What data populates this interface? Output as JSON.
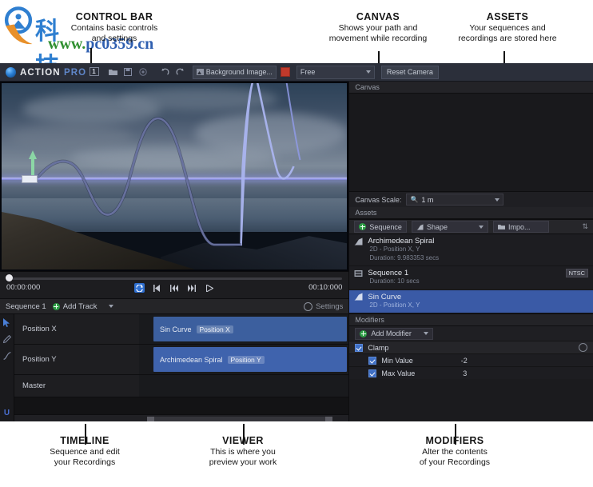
{
  "annotations": {
    "control_bar": {
      "title": "CONTROL BAR",
      "desc": "Contains basic controls\nand settings"
    },
    "canvas": {
      "title": "CANVAS",
      "desc": "Shows your path and\nmovement while recording"
    },
    "assets": {
      "title": "ASSETS",
      "desc": "Your sequences and\nrecordings are stored here"
    },
    "timeline": {
      "title": "TIMELINE",
      "desc": "Sequence and edit\nyour Recordings"
    },
    "viewer": {
      "title": "VIEWER",
      "desc": "This is where you\npreview your work"
    },
    "modifiers": {
      "title": "MODIFIERS",
      "desc": "Alter the contents\nof your Recordings"
    }
  },
  "watermark": {
    "chinese": "科技软件园",
    "url_www": "www.",
    "url_main": "pc0359",
    "url_tld": ".cn"
  },
  "control_bar": {
    "brand_action": "ACTION",
    "brand_pro": "PRO",
    "brand_badge": "1",
    "icons": [
      "folder-icon",
      "save-icon",
      "record-icon",
      "undo-icon",
      "redo-icon"
    ],
    "background_field": "Background Image...",
    "camera_mode": "Free",
    "reset_camera": "Reset Camera"
  },
  "timebar": {
    "current_time": "00:00:000",
    "end_time": "00:10:000",
    "transport": [
      "loop-icon",
      "skip-start-icon",
      "step-back-icon",
      "step-forward-icon",
      "play-icon"
    ]
  },
  "sequence_bar": {
    "sequence_name": "Sequence 1",
    "add_track": "Add Track",
    "settings": "Settings"
  },
  "tools": [
    "select-tool-icon",
    "pen-tool-icon",
    "curve-tool-icon",
    "u-tool-icon"
  ],
  "tracks": [
    {
      "name": "Position X",
      "clip_label": "Sin Curve",
      "clip_pill": "Position X",
      "has_clip": true
    },
    {
      "name": "Position Y",
      "clip_label": "Archimedean Spiral",
      "clip_pill": "Position Y",
      "has_clip": true
    },
    {
      "name": "Master",
      "clip_label": "",
      "clip_pill": "",
      "has_clip": false
    }
  ],
  "canvas_panel": {
    "header": "Canvas",
    "scale_label": "Canvas Scale:",
    "scale_value": "1 m"
  },
  "assets_panel": {
    "header": "Assets",
    "sequence_button": "Sequence",
    "shape_button": "Shape",
    "import_button": "Impo...",
    "items": [
      {
        "title": "Archimedean Spiral",
        "sub1": "2D - Position X, Y",
        "sub2": "Duration: 9.983353 secs",
        "badge": "",
        "selected": false,
        "icon": "shape-icon"
      },
      {
        "title": "Sequence 1",
        "sub1": "Duration: 10 secs",
        "sub2": "",
        "badge": "NTSC",
        "selected": false,
        "icon": "sequence-icon"
      },
      {
        "title": "Sin Curve",
        "sub1": "2D - Position X, Y",
        "sub2": "",
        "badge": "",
        "selected": true,
        "icon": "shape-icon"
      }
    ]
  },
  "modifiers_panel": {
    "header": "Modifiers",
    "add_modifier": "Add Modifier",
    "modifier_name": "Clamp",
    "rows": [
      {
        "label": "Min Value",
        "value": "-2"
      },
      {
        "label": "Max Value",
        "value": "3"
      }
    ]
  },
  "colors": {
    "accent_blue": "#3f6fc4",
    "selection_blue": "#3a5aa6",
    "green_add": "#2e9e46",
    "record_red": "#c0392b",
    "panel_bg": "#1f1f22"
  }
}
